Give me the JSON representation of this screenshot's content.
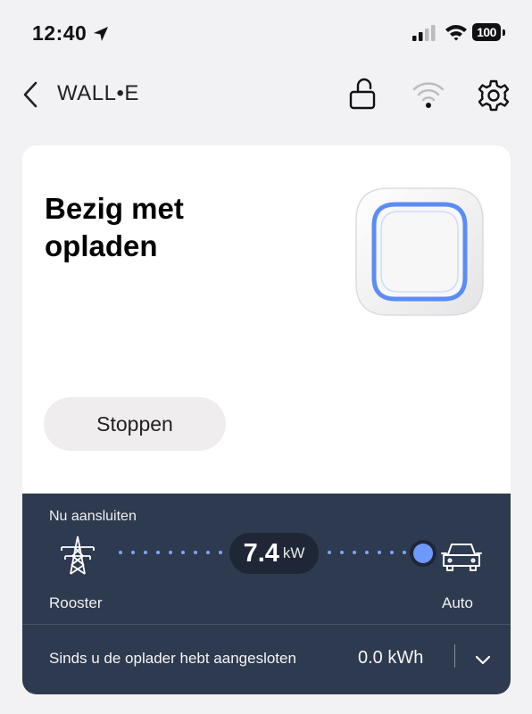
{
  "status_bar": {
    "time": "12:40",
    "battery": "100",
    "icons": [
      "location-arrow-icon",
      "cellular-signal-icon",
      "wifi-icon",
      "battery-icon"
    ]
  },
  "nav": {
    "title": "WALL•E",
    "icons": [
      "chevron-left-icon",
      "lock-open-icon",
      "wifi-icon",
      "gear-icon"
    ]
  },
  "card": {
    "heading": "Bezig met opladen",
    "stop_label": "Stoppen",
    "accent_color": "#5b8cf5"
  },
  "panel": {
    "label": "Nu aansluiten",
    "source_label": "Rooster",
    "target_label": "Auto",
    "power_value": "7.4",
    "power_unit": "kW",
    "energy_label": "Sinds u de oplader hebt aangesloten",
    "energy_value": "0.0 kWh",
    "background_color": "#2e3a4f",
    "flow_color": "#6d99ff"
  }
}
